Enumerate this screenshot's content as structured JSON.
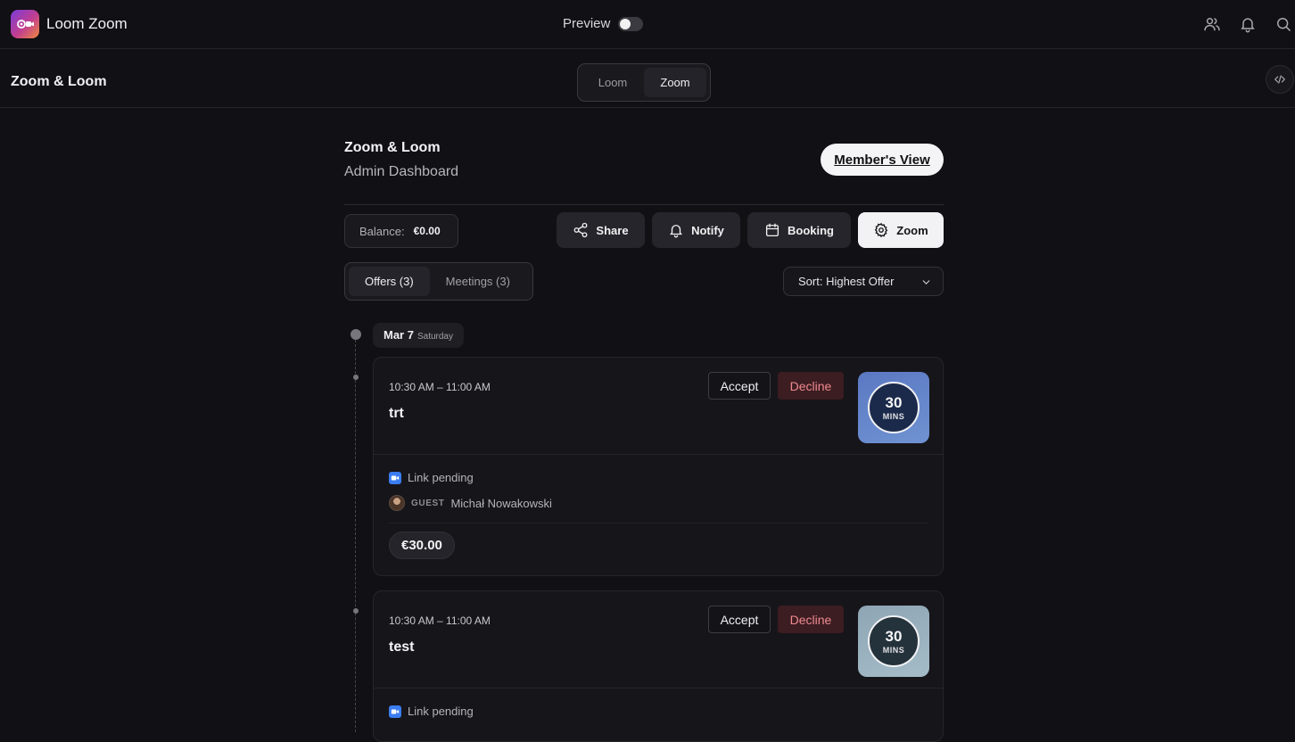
{
  "app": {
    "title": "Loom Zoom",
    "preview_label": "Preview"
  },
  "subheader": {
    "title": "Zoom & Loom",
    "segments": [
      "Loom",
      "Zoom"
    ],
    "active_segment": "Zoom"
  },
  "header": {
    "title": "Zoom & Loom",
    "subtitle": "Admin Dashboard",
    "member_view_label": "Member's View"
  },
  "balance": {
    "label": "Balance:",
    "value": "€0.00"
  },
  "actions": {
    "share": "Share",
    "notify": "Notify",
    "booking": "Booking",
    "zoom": "Zoom"
  },
  "tabs": {
    "offers": "Offers (3)",
    "meetings": "Meetings (3)"
  },
  "sort": {
    "label": "Sort: Highest Offer"
  },
  "timeline": {
    "date": "Mar 7",
    "weekday": "Saturday"
  },
  "offers": [
    {
      "time": "10:30 AM – 11:00 AM",
      "title": "trt",
      "accept_label": "Accept",
      "decline_label": "Decline",
      "duration": "30",
      "duration_unit": "MINS",
      "badge_color": "#6283c8",
      "link_status": "Link pending",
      "guest_tag": "GUEST",
      "guest_name": "Michał Nowakowski",
      "price": "€30.00"
    },
    {
      "time": "10:30 AM – 11:00 AM",
      "title": "test",
      "accept_label": "Accept",
      "decline_label": "Decline",
      "duration": "30",
      "duration_unit": "MINS",
      "badge_color": "#9ab1bf",
      "link_status": "Link pending"
    }
  ],
  "colors": {
    "background": "#111014",
    "decline_text": "#ef8a90",
    "zoom_blue": "#3b7df0"
  }
}
